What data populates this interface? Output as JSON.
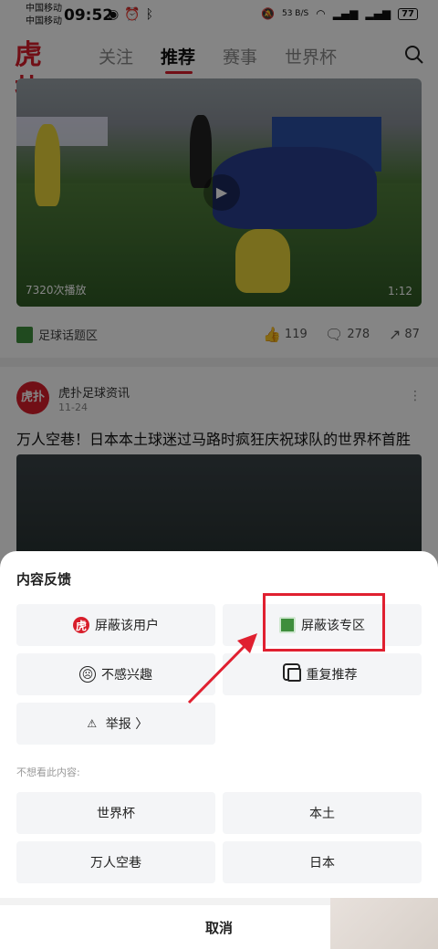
{
  "status_bar": {
    "carrier_1": "中国移动",
    "carrier_2": "中国移动",
    "time": "09:52",
    "net_speed": "53 B/S",
    "battery": "77"
  },
  "app_bar": {
    "logo_text": "虎扑",
    "tabs": [
      {
        "label": "关注"
      },
      {
        "label": "推荐"
      },
      {
        "label": "赛事"
      },
      {
        "label": "世界杯"
      }
    ],
    "active_tab": "推荐",
    "accent_color": "#d81e2b"
  },
  "feed": {
    "video": {
      "views": "7320次播放",
      "duration": "1:12"
    },
    "post1_meta": {
      "zone": "足球话题区",
      "likes": "119",
      "comments": "278",
      "shares": "87"
    },
    "post2": {
      "author": "虎扑足球资讯",
      "date": "11-24",
      "title": "万人空巷！日本本土球迷过马路时疯狂庆祝球队的世界杯首胜"
    }
  },
  "sheet": {
    "title": "内容反馈",
    "options": {
      "block_user": "屏蔽该用户",
      "block_zone": "屏蔽该专区",
      "not_interested": "不感兴趣",
      "duplicate": "重复推荐",
      "report": "举报 〉"
    },
    "sub_label": "不想看此内容:",
    "keywords": [
      "世界杯",
      "本土",
      "万人空巷",
      "日本"
    ],
    "cancel": "取消",
    "highlight_color": "#e02030"
  }
}
